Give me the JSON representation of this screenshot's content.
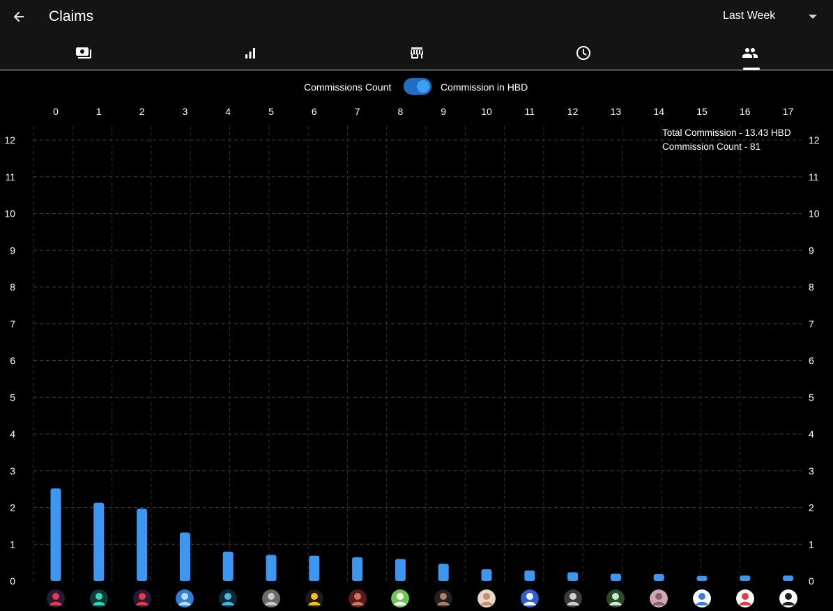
{
  "header": {
    "title": "Claims",
    "range_selected": "Last Week"
  },
  "tabs": [
    {
      "icon": "cash-icon"
    },
    {
      "icon": "bar-chart-icon"
    },
    {
      "icon": "store-icon"
    },
    {
      "icon": "clock-icon"
    },
    {
      "icon": "people-icon",
      "active": true
    }
  ],
  "toggle": {
    "left_label": "Commissions Count",
    "right_label": "Commission in HBD",
    "on": true
  },
  "summary": {
    "total_commission": "Total Commission - 13.43 HBD",
    "commission_count": "Commission Count - 81"
  },
  "chart_data": {
    "type": "bar",
    "x": [
      0,
      1,
      2,
      3,
      4,
      5,
      6,
      7,
      8,
      9,
      10,
      11,
      12,
      13,
      14,
      15,
      16,
      17
    ],
    "values": [
      2.52,
      2.13,
      1.97,
      1.32,
      0.8,
      0.71,
      0.69,
      0.65,
      0.6,
      0.47,
      0.32,
      0.29,
      0.24,
      0.2,
      0.19,
      0.14,
      0.15,
      0.15
    ],
    "ylim": [
      0,
      12
    ],
    "yticks": [
      0,
      1,
      2,
      3,
      4,
      5,
      6,
      7,
      8,
      9,
      10,
      11,
      12
    ],
    "grid": true,
    "color": "#3d96f0"
  },
  "avatars": [
    {
      "bg": "#2a1a3a",
      "fg": "#e23b4a"
    },
    {
      "bg": "#0f3a3a",
      "fg": "#3bd3b5"
    },
    {
      "bg": "#2a1a3a",
      "fg": "#e23b4a"
    },
    {
      "bg": "#2f7fd6",
      "fg": "#b7dcff"
    },
    {
      "bg": "#0b2a3a",
      "fg": "#48b8e0"
    },
    {
      "bg": "#6b6b6b",
      "fg": "#d0c6c0"
    },
    {
      "bg": "#1b1b1b",
      "fg": "#f2c20d"
    },
    {
      "bg": "#5a1a1a",
      "fg": "#c57a60"
    },
    {
      "bg": "#6ac94a",
      "fg": "#ffffff"
    },
    {
      "bg": "#222222",
      "fg": "#b08060"
    },
    {
      "bg": "#e9d8c8",
      "fg": "#c09070"
    },
    {
      "bg": "#2f5fd6",
      "fg": "#ffffff"
    },
    {
      "bg": "#3a3a3a",
      "fg": "#d0d0d0"
    },
    {
      "bg": "#2a4a2a",
      "fg": "#cfe8cf"
    },
    {
      "bg": "#cfa8b8",
      "fg": "#8a6070"
    },
    {
      "bg": "#ffffff",
      "fg": "#3a7fd6"
    },
    {
      "bg": "#ffffff",
      "fg": "#e23b4a"
    },
    {
      "bg": "#ffffff",
      "fg": "#222222"
    }
  ]
}
